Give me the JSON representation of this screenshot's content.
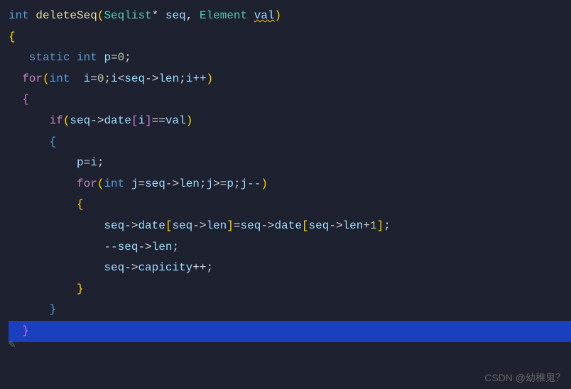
{
  "code": {
    "l1_int": "int",
    "l1_func": "deleteSeq",
    "l1_type": "Seqlist",
    "l1_star": "*",
    "l1_p1": "seq",
    "l1_comma": ", ",
    "l1_type2": "Element",
    "l1_p2": "val",
    "l2_brace": "{",
    "l3_static": "static",
    "l3_int": "int",
    "l3_var": "p",
    "l3_eq": "=",
    "l3_val": "0",
    "l3_semi": ";",
    "l4_for": "for",
    "l4_int": "int",
    "l4_i": "i",
    "l4_eq": "=",
    "l4_zero": "0",
    "l4_cond_i": "i",
    "l4_lt": "<",
    "l4_seq": "seq",
    "l4_arrow": "->",
    "l4_len": "len",
    "l4_inc": "i++",
    "l5_brace": "{",
    "l6_if": "if",
    "l6_seq": "seq",
    "l6_arrow": "->",
    "l6_date": "date",
    "l6_i": "i",
    "l6_eqeq": "==",
    "l6_val": "val",
    "l7_brace": "{",
    "l8_p": "p",
    "l8_eq": "=",
    "l8_i": "i",
    "l8_semi": ";",
    "l9_for": "for",
    "l9_int": "int",
    "l9_j": "j",
    "l9_eq": "=",
    "l9_seq": "seq",
    "l9_arrow": "->",
    "l9_len": "len",
    "l9_j2": "j",
    "l9_ge": ">=",
    "l9_p": "p",
    "l9_dec": "j--",
    "l10_brace": "{",
    "l11_seq1": "seq",
    "l11_arrow1": "->",
    "l11_date1": "date",
    "l11_seq2": "seq",
    "l11_arrow2": "->",
    "l11_len1": "len",
    "l11_eq": "=",
    "l11_seq3": "seq",
    "l11_arrow3": "->",
    "l11_date2": "date",
    "l11_seq4": "seq",
    "l11_arrow4": "->",
    "l11_len2": "len",
    "l11_plus": "+",
    "l11_one": "1",
    "l11_semi": ";",
    "l12_dec": "--",
    "l12_seq": "seq",
    "l12_arrow": "->",
    "l12_len": "len",
    "l12_semi": ";",
    "l13_seq": "seq",
    "l13_arrow": "->",
    "l13_cap": "capicity",
    "l13_inc": "++",
    "l13_semi": ";",
    "l14_brace": "}",
    "l15_brace": "}",
    "l16_brace": "}"
  },
  "watermark": "CSDN @幼稚鬼？",
  "edit_icon": "✎"
}
